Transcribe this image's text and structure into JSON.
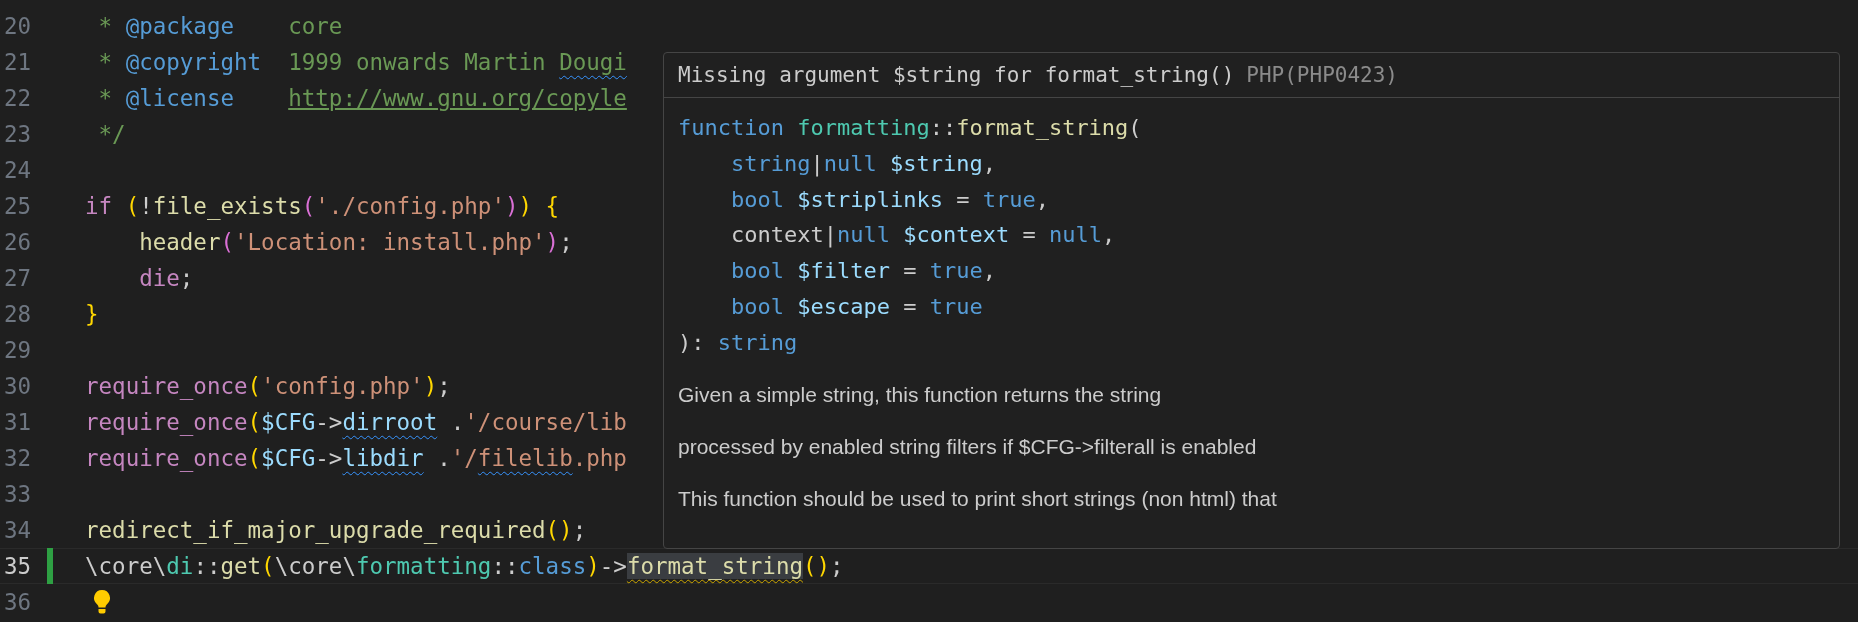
{
  "editor": {
    "lines": [
      {
        "number": "20",
        "active": false,
        "modified": false,
        "lightbulb": false,
        "tokens": [
          {
            "text": " * ",
            "kind": "comment"
          },
          {
            "text": "@package",
            "kind": "doctag"
          },
          {
            "text": "    core",
            "kind": "comment"
          }
        ]
      },
      {
        "number": "21",
        "active": false,
        "modified": false,
        "lightbulb": false,
        "tokens": [
          {
            "text": " * ",
            "kind": "comment"
          },
          {
            "text": "@copyright",
            "kind": "doctag"
          },
          {
            "text": "  1999 onwards Martin ",
            "kind": "comment"
          },
          {
            "text": "Dougi",
            "kind": "comment",
            "info_squiggle": true
          }
        ]
      },
      {
        "number": "22",
        "active": false,
        "modified": false,
        "lightbulb": false,
        "tokens": [
          {
            "text": " * ",
            "kind": "comment"
          },
          {
            "text": "@license    ",
            "kind": "doctag"
          },
          {
            "text": "http://www.gnu.org/copyle",
            "kind": "link"
          }
        ]
      },
      {
        "number": "23",
        "active": false,
        "modified": false,
        "lightbulb": false,
        "tokens": [
          {
            "text": " */",
            "kind": "comment"
          }
        ]
      },
      {
        "number": "24",
        "active": false,
        "modified": false,
        "lightbulb": false
      },
      {
        "number": "25",
        "active": false,
        "modified": false,
        "lightbulb": false,
        "tokens": [
          {
            "text": "if",
            "kind": "control"
          },
          {
            "text": " (",
            "kind": "bracket"
          },
          {
            "text": "!",
            "kind": "plain"
          },
          {
            "text": "file_exists",
            "kind": "func"
          },
          {
            "text": "(",
            "kind": "bracket2"
          },
          {
            "text": "'./config.php'",
            "kind": "string"
          },
          {
            "text": ")",
            "kind": "bracket2"
          },
          {
            "text": ")",
            "kind": "bracket"
          },
          {
            "text": " {",
            "kind": "bracket"
          }
        ]
      },
      {
        "number": "26",
        "active": false,
        "modified": false,
        "lightbulb": false,
        "tokens": [
          {
            "text": "    header",
            "kind": "func"
          },
          {
            "text": "(",
            "kind": "bracket2"
          },
          {
            "text": "'Location: install.php'",
            "kind": "string"
          },
          {
            "text": ")",
            "kind": "bracket2"
          },
          {
            "text": ";",
            "kind": "plain"
          }
        ]
      },
      {
        "number": "27",
        "active": false,
        "modified": false,
        "lightbulb": false,
        "tokens": [
          {
            "text": "    die",
            "kind": "control"
          },
          {
            "text": ";",
            "kind": "plain"
          }
        ]
      },
      {
        "number": "28",
        "active": false,
        "modified": false,
        "lightbulb": false,
        "tokens": [
          {
            "text": "}",
            "kind": "bracket"
          }
        ]
      },
      {
        "number": "29",
        "active": false,
        "modified": false,
        "lightbulb": false
      },
      {
        "number": "30",
        "active": false,
        "modified": false,
        "lightbulb": false,
        "tokens": [
          {
            "text": "require_once",
            "kind": "control"
          },
          {
            "text": "(",
            "kind": "bracket"
          },
          {
            "text": "'config.php'",
            "kind": "string"
          },
          {
            "text": ")",
            "kind": "bracket"
          },
          {
            "text": ";",
            "kind": "plain"
          }
        ]
      },
      {
        "number": "31",
        "active": false,
        "modified": false,
        "lightbulb": false,
        "tokens": [
          {
            "text": "require_once",
            "kind": "control"
          },
          {
            "text": "(",
            "kind": "bracket"
          },
          {
            "text": "$CFG",
            "kind": "var"
          },
          {
            "text": "->",
            "kind": "plain"
          },
          {
            "text": "dirroot",
            "kind": "var",
            "info_squiggle": true
          },
          {
            "text": " .",
            "kind": "plain"
          },
          {
            "text": "'/course/lib",
            "kind": "string"
          }
        ]
      },
      {
        "number": "32",
        "active": false,
        "modified": false,
        "lightbulb": false,
        "tokens": [
          {
            "text": "require_once",
            "kind": "control"
          },
          {
            "text": "(",
            "kind": "bracket"
          },
          {
            "text": "$CFG",
            "kind": "var"
          },
          {
            "text": "->",
            "kind": "plain"
          },
          {
            "text": "libdir",
            "kind": "var",
            "info_squiggle": true
          },
          {
            "text": " .",
            "kind": "plain"
          },
          {
            "text": "'/",
            "kind": "string"
          },
          {
            "text": "filelib",
            "kind": "string",
            "info_squiggle": true
          },
          {
            "text": ".php",
            "kind": "string"
          }
        ]
      },
      {
        "number": "33",
        "active": false,
        "modified": false,
        "lightbulb": false
      },
      {
        "number": "34",
        "active": false,
        "modified": false,
        "lightbulb": false,
        "tokens": [
          {
            "text": "redirect_if_major_upgrade_required",
            "kind": "func"
          },
          {
            "text": "()",
            "kind": "bracket"
          },
          {
            "text": ";",
            "kind": "plain"
          }
        ]
      },
      {
        "number": "35",
        "active": true,
        "modified": true,
        "lightbulb": false,
        "tokens": [
          {
            "text": "\\core\\",
            "kind": "plain"
          },
          {
            "text": "di",
            "kind": "type"
          },
          {
            "text": "::",
            "kind": "plain"
          },
          {
            "text": "get",
            "kind": "func"
          },
          {
            "text": "(",
            "kind": "bracket"
          },
          {
            "text": "\\core\\",
            "kind": "plain"
          },
          {
            "text": "formatting",
            "kind": "type"
          },
          {
            "text": "::",
            "kind": "plain"
          },
          {
            "text": "class",
            "kind": "keyword"
          },
          {
            "text": ")",
            "kind": "bracket"
          },
          {
            "text": "->",
            "kind": "plain"
          },
          {
            "text": "format_string",
            "kind": "func",
            "warning_squiggle": true,
            "highlight": true
          },
          {
            "text": "()",
            "kind": "bracket"
          },
          {
            "text": ";",
            "kind": "plain"
          }
        ]
      },
      {
        "number": "36",
        "active": false,
        "modified": false,
        "lightbulb": true
      }
    ]
  },
  "tooltip": {
    "message": "Missing argument $string for format_string()",
    "source": "PHP(PHP0423)",
    "signature": [
      [
        {
          "text": "function",
          "kind": "keyword"
        },
        {
          "text": " formatting",
          "kind": "type"
        },
        {
          "text": "::",
          "kind": "plain"
        },
        {
          "text": "format_string",
          "kind": "func"
        },
        {
          "text": "(",
          "kind": "plain"
        }
      ],
      [
        {
          "text": "    string",
          "kind": "keyword"
        },
        {
          "text": "|",
          "kind": "plain"
        },
        {
          "text": "null",
          "kind": "keyword"
        },
        {
          "text": " $string",
          "kind": "var"
        },
        {
          "text": ",",
          "kind": "plain"
        }
      ],
      [
        {
          "text": "    bool",
          "kind": "keyword"
        },
        {
          "text": " $striplinks",
          "kind": "var"
        },
        {
          "text": " = ",
          "kind": "plain"
        },
        {
          "text": "true",
          "kind": "keyword"
        },
        {
          "text": ",",
          "kind": "plain"
        }
      ],
      [
        {
          "text": "    context|",
          "kind": "plain"
        },
        {
          "text": "null",
          "kind": "keyword"
        },
        {
          "text": " $context",
          "kind": "var"
        },
        {
          "text": " = ",
          "kind": "plain"
        },
        {
          "text": "null",
          "kind": "keyword"
        },
        {
          "text": ",",
          "kind": "plain"
        }
      ],
      [
        {
          "text": "    bool",
          "kind": "keyword"
        },
        {
          "text": " $filter",
          "kind": "var"
        },
        {
          "text": " = ",
          "kind": "plain"
        },
        {
          "text": "true",
          "kind": "keyword"
        },
        {
          "text": ",",
          "kind": "plain"
        }
      ],
      [
        {
          "text": "    bool",
          "kind": "keyword"
        },
        {
          "text": " $escape",
          "kind": "var"
        },
        {
          "text": " = ",
          "kind": "plain"
        },
        {
          "text": "true",
          "kind": "keyword"
        }
      ],
      [
        {
          "text": "): ",
          "kind": "plain"
        },
        {
          "text": "string",
          "kind": "keyword"
        }
      ]
    ],
    "description": [
      "Given a simple string, this function returns the string",
      "processed by enabled string filters if $CFG->filterall is enabled",
      "This function should be used to print short strings (non html) that"
    ]
  }
}
